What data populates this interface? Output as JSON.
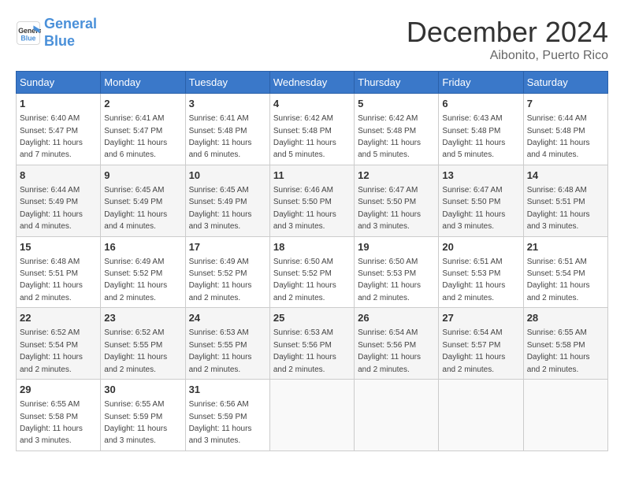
{
  "logo": {
    "line1": "General",
    "line2": "Blue"
  },
  "title": "December 2024",
  "location": "Aibonito, Puerto Rico",
  "days_of_week": [
    "Sunday",
    "Monday",
    "Tuesday",
    "Wednesday",
    "Thursday",
    "Friday",
    "Saturday"
  ],
  "weeks": [
    [
      {
        "num": "1",
        "sunrise": "6:40 AM",
        "sunset": "5:47 PM",
        "daylight": "11 hours and 7 minutes."
      },
      {
        "num": "2",
        "sunrise": "6:41 AM",
        "sunset": "5:47 PM",
        "daylight": "11 hours and 6 minutes."
      },
      {
        "num": "3",
        "sunrise": "6:41 AM",
        "sunset": "5:48 PM",
        "daylight": "11 hours and 6 minutes."
      },
      {
        "num": "4",
        "sunrise": "6:42 AM",
        "sunset": "5:48 PM",
        "daylight": "11 hours and 5 minutes."
      },
      {
        "num": "5",
        "sunrise": "6:42 AM",
        "sunset": "5:48 PM",
        "daylight": "11 hours and 5 minutes."
      },
      {
        "num": "6",
        "sunrise": "6:43 AM",
        "sunset": "5:48 PM",
        "daylight": "11 hours and 5 minutes."
      },
      {
        "num": "7",
        "sunrise": "6:44 AM",
        "sunset": "5:48 PM",
        "daylight": "11 hours and 4 minutes."
      }
    ],
    [
      {
        "num": "8",
        "sunrise": "6:44 AM",
        "sunset": "5:49 PM",
        "daylight": "11 hours and 4 minutes."
      },
      {
        "num": "9",
        "sunrise": "6:45 AM",
        "sunset": "5:49 PM",
        "daylight": "11 hours and 4 minutes."
      },
      {
        "num": "10",
        "sunrise": "6:45 AM",
        "sunset": "5:49 PM",
        "daylight": "11 hours and 3 minutes."
      },
      {
        "num": "11",
        "sunrise": "6:46 AM",
        "sunset": "5:50 PM",
        "daylight": "11 hours and 3 minutes."
      },
      {
        "num": "12",
        "sunrise": "6:47 AM",
        "sunset": "5:50 PM",
        "daylight": "11 hours and 3 minutes."
      },
      {
        "num": "13",
        "sunrise": "6:47 AM",
        "sunset": "5:50 PM",
        "daylight": "11 hours and 3 minutes."
      },
      {
        "num": "14",
        "sunrise": "6:48 AM",
        "sunset": "5:51 PM",
        "daylight": "11 hours and 3 minutes."
      }
    ],
    [
      {
        "num": "15",
        "sunrise": "6:48 AM",
        "sunset": "5:51 PM",
        "daylight": "11 hours and 2 minutes."
      },
      {
        "num": "16",
        "sunrise": "6:49 AM",
        "sunset": "5:52 PM",
        "daylight": "11 hours and 2 minutes."
      },
      {
        "num": "17",
        "sunrise": "6:49 AM",
        "sunset": "5:52 PM",
        "daylight": "11 hours and 2 minutes."
      },
      {
        "num": "18",
        "sunrise": "6:50 AM",
        "sunset": "5:52 PM",
        "daylight": "11 hours and 2 minutes."
      },
      {
        "num": "19",
        "sunrise": "6:50 AM",
        "sunset": "5:53 PM",
        "daylight": "11 hours and 2 minutes."
      },
      {
        "num": "20",
        "sunrise": "6:51 AM",
        "sunset": "5:53 PM",
        "daylight": "11 hours and 2 minutes."
      },
      {
        "num": "21",
        "sunrise": "6:51 AM",
        "sunset": "5:54 PM",
        "daylight": "11 hours and 2 minutes."
      }
    ],
    [
      {
        "num": "22",
        "sunrise": "6:52 AM",
        "sunset": "5:54 PM",
        "daylight": "11 hours and 2 minutes."
      },
      {
        "num": "23",
        "sunrise": "6:52 AM",
        "sunset": "5:55 PM",
        "daylight": "11 hours and 2 minutes."
      },
      {
        "num": "24",
        "sunrise": "6:53 AM",
        "sunset": "5:55 PM",
        "daylight": "11 hours and 2 minutes."
      },
      {
        "num": "25",
        "sunrise": "6:53 AM",
        "sunset": "5:56 PM",
        "daylight": "11 hours and 2 minutes."
      },
      {
        "num": "26",
        "sunrise": "6:54 AM",
        "sunset": "5:56 PM",
        "daylight": "11 hours and 2 minutes."
      },
      {
        "num": "27",
        "sunrise": "6:54 AM",
        "sunset": "5:57 PM",
        "daylight": "11 hours and 2 minutes."
      },
      {
        "num": "28",
        "sunrise": "6:55 AM",
        "sunset": "5:58 PM",
        "daylight": "11 hours and 2 minutes."
      }
    ],
    [
      {
        "num": "29",
        "sunrise": "6:55 AM",
        "sunset": "5:58 PM",
        "daylight": "11 hours and 3 minutes."
      },
      {
        "num": "30",
        "sunrise": "6:55 AM",
        "sunset": "5:59 PM",
        "daylight": "11 hours and 3 minutes."
      },
      {
        "num": "31",
        "sunrise": "6:56 AM",
        "sunset": "5:59 PM",
        "daylight": "11 hours and 3 minutes."
      },
      null,
      null,
      null,
      null
    ]
  ],
  "labels": {
    "sunrise": "Sunrise:",
    "sunset": "Sunset:",
    "daylight": "Daylight:"
  }
}
